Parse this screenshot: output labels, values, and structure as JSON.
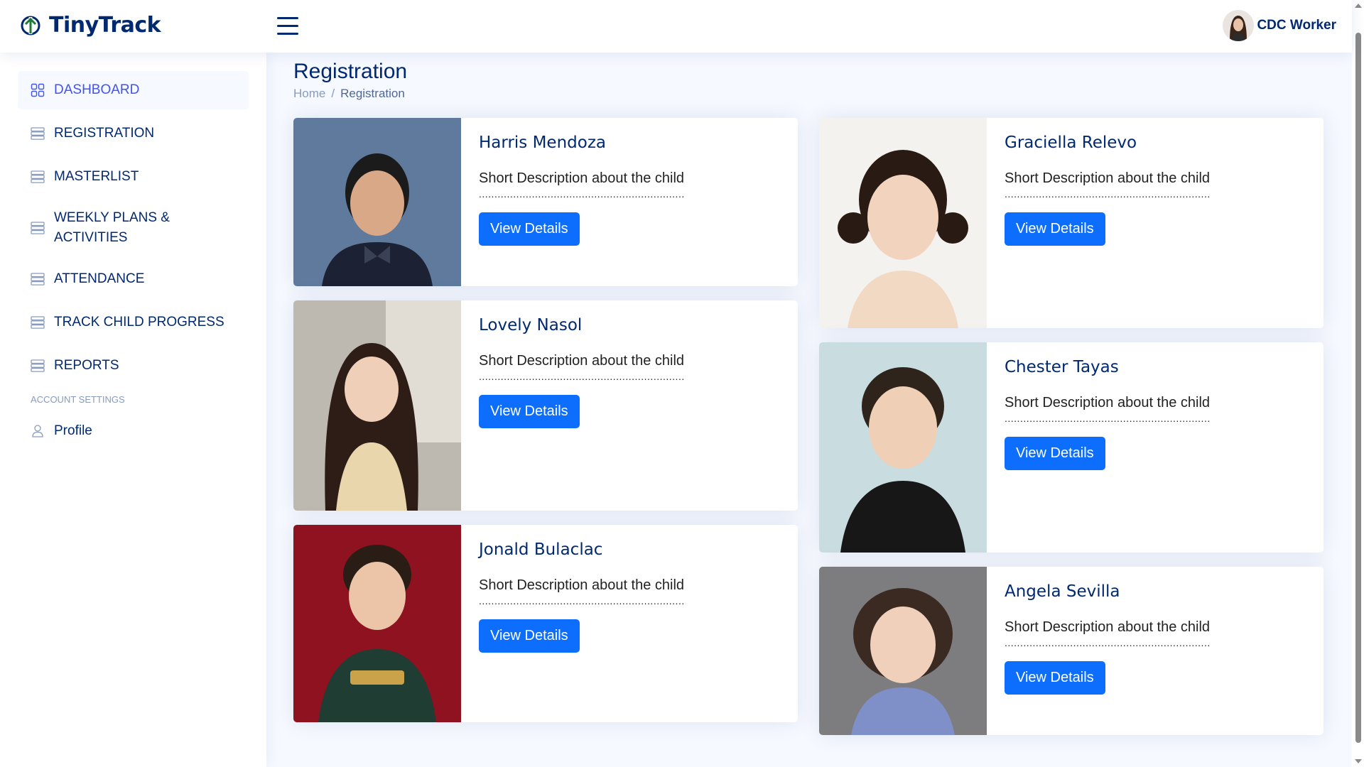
{
  "header": {
    "app_name": "TinyTrack",
    "user_name": "CDC Worker"
  },
  "sidebar": {
    "items": [
      {
        "label": "DASHBOARD",
        "icon": "grid-icon",
        "active": true
      },
      {
        "label": "REGISTRATION",
        "icon": "list-icon"
      },
      {
        "label": "MASTERLIST",
        "icon": "list-icon"
      },
      {
        "label": "WEEKLY PLANS & ACTIVITIES",
        "icon": "list-icon"
      },
      {
        "label": "ATTENDANCE",
        "icon": "list-icon"
      },
      {
        "label": "TRACK CHILD PROGRESS",
        "icon": "list-icon"
      },
      {
        "label": "REPORTS",
        "icon": "list-icon"
      }
    ],
    "section_heading": "ACCOUNT SETTINGS",
    "profile_label": "Profile"
  },
  "main": {
    "title": "Registration",
    "breadcrumb": {
      "home": "Home",
      "separator": "/",
      "current": "Registration"
    }
  },
  "cards": [
    {
      "name": "Harris Mendoza",
      "description": "Short Description about the child",
      "dots": "..................................................................",
      "button": "View Details"
    },
    {
      "name": "Lovely Nasol",
      "description": "Short Description about the child",
      "dots": "..................................................................",
      "button": "View Details"
    },
    {
      "name": "Jonald Bulaclac",
      "description": "Short Description about the child",
      "dots": "..................................................................",
      "button": "View Details"
    },
    {
      "name": "Graciella Relevo",
      "description": "Short Description about the child",
      "dots": "..................................................................",
      "button": "View Details"
    },
    {
      "name": "Chester Tayas",
      "description": "Short Description about the child",
      "dots": "..................................................................",
      "button": "View Details"
    },
    {
      "name": "Angela Sevilla",
      "description": "Short Description about the child",
      "dots": "..................................................................",
      "button": "View Details"
    }
  ],
  "colors": {
    "brand": "#012970",
    "accent": "#4154f1",
    "button": "#0d6efd",
    "background": "#f6f9ff"
  }
}
